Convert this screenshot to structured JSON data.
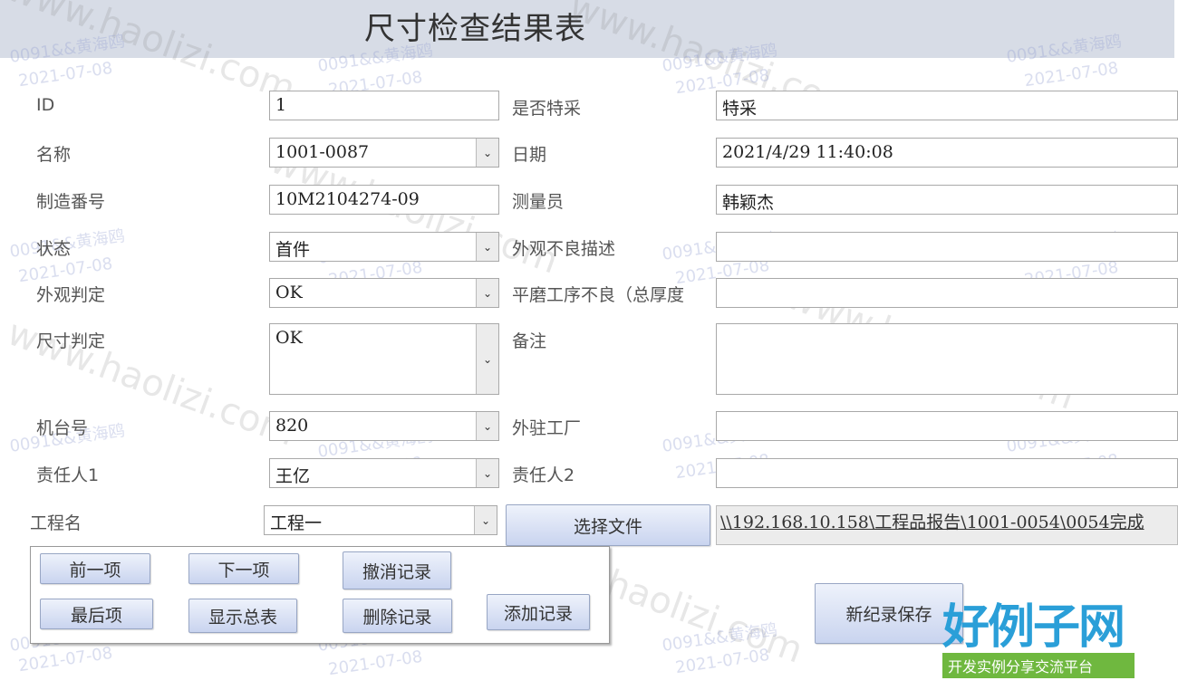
{
  "title": "尺寸检查结果表",
  "left_fields": [
    {
      "label": "ID",
      "value": "1"
    },
    {
      "label": "名称",
      "value": "1001-0087"
    },
    {
      "label": "制造番号",
      "value": "10M2104274-09"
    },
    {
      "label": "状态",
      "value": "首件"
    },
    {
      "label": "外观判定",
      "value": "OK"
    },
    {
      "label": "尺寸判定",
      "value": "OK"
    },
    {
      "label": "机台号",
      "value": "820"
    },
    {
      "label": "责任人1",
      "value": "王亿"
    },
    {
      "label": "工程名",
      "value": "工程一"
    }
  ],
  "right_fields": [
    {
      "label": "是否特采",
      "value": "特采"
    },
    {
      "label": "日期",
      "value": "2021/4/29 11:40:08"
    },
    {
      "label": "测量员",
      "value": "韩颖杰"
    },
    {
      "label": "外观不良描述",
      "value": ""
    },
    {
      "label": "平磨工序不良（总厚度",
      "value": ""
    },
    {
      "label": "备注",
      "value": ""
    },
    {
      "label": "外驻工厂",
      "value": ""
    },
    {
      "label": "责任人2",
      "value": ""
    }
  ],
  "select_file_button": "选择文件",
  "file_path": "\\\\192.168.10.158\\工程品报告\\1001-0054\\0054完成",
  "nav_buttons": {
    "prev": "前一项",
    "next": "下一项",
    "cancel": "撤消记录",
    "last": "最后项",
    "show_all": "显示总表",
    "delete": "删除记录",
    "add": "添加记录"
  },
  "save_button": "新纪录保存",
  "watermark": {
    "id": "0091&&黄海鸥",
    "date": "2021-07-08",
    "site": "www.haolizi.com"
  },
  "logo": {
    "name": "好例子网",
    "slogan": "开发实例分享交流平台"
  },
  "colors": {
    "title_bar": "#d7dce6",
    "button": "#c9d4ef",
    "logo_blue": "#2a9fd8",
    "logo_green": "#6fb83f"
  }
}
